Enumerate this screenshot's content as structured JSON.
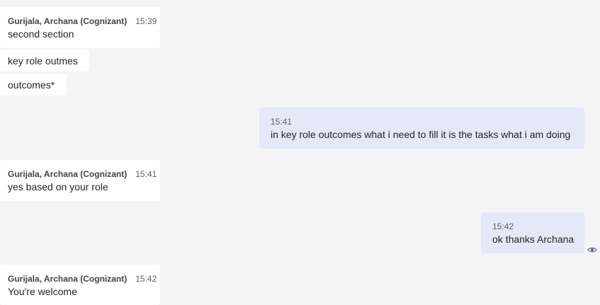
{
  "messages": [
    {
      "sender": "Gurijala, Archana (Cognizant)",
      "time": "15:39",
      "text": "second section"
    },
    {
      "text": "key role outmes"
    },
    {
      "text": "outcomes*"
    },
    {
      "time": "15:41",
      "text": "in key role outcomes what i need to fill it is the tasks what i am doing"
    },
    {
      "sender": "Gurijala, Archana (Cognizant)",
      "time": "15:41",
      "text": "yes based on your role"
    },
    {
      "time": "15:42",
      "text": "ok thanks Archana"
    },
    {
      "sender": "Gurijala, Archana (Cognizant)",
      "time": "15:42",
      "text": "You're welcome"
    }
  ],
  "icons": {
    "read_receipt": "eye-icon"
  },
  "colors": {
    "background": "#f4f4f4",
    "incoming": "#ffffff",
    "outgoing": "#e5e8f8"
  }
}
